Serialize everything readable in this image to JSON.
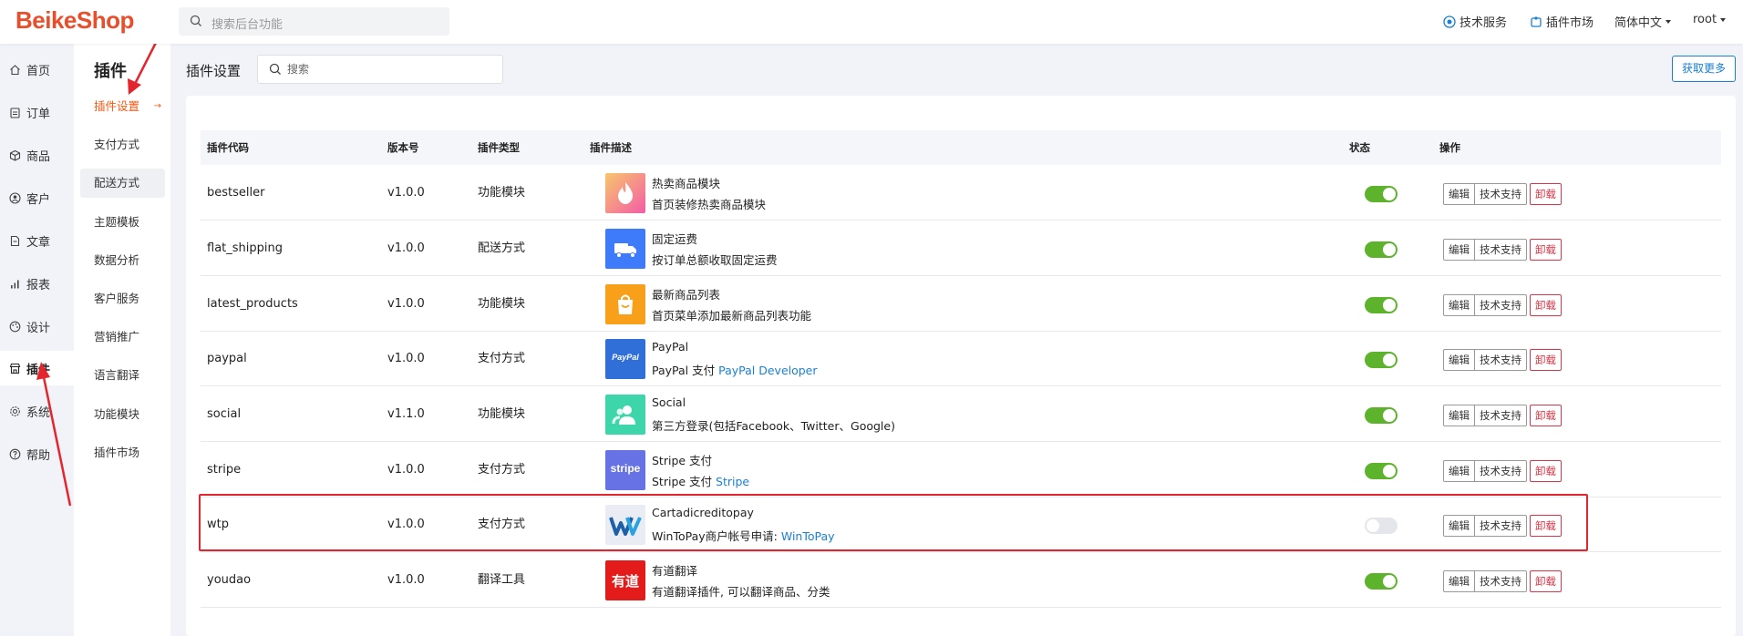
{
  "header": {
    "logo": "BeikeShop",
    "search_placeholder": "搜索后台功能",
    "tech_service": "技术服务",
    "plugin_market": "插件市场",
    "language": "简体中文",
    "user": "root"
  },
  "sidebar": {
    "items": [
      {
        "label": "首页",
        "icon": "home-icon"
      },
      {
        "label": "订单",
        "icon": "clipboard-icon"
      },
      {
        "label": "商品",
        "icon": "box-icon"
      },
      {
        "label": "客户",
        "icon": "user-icon"
      },
      {
        "label": "文章",
        "icon": "document-icon"
      },
      {
        "label": "报表",
        "icon": "chart-icon"
      },
      {
        "label": "设计",
        "icon": "palette-icon"
      },
      {
        "label": "插件",
        "icon": "store-icon"
      },
      {
        "label": "系统",
        "icon": "gear-icon"
      },
      {
        "label": "帮助",
        "icon": "question-icon"
      }
    ]
  },
  "subnav": {
    "title": "插件",
    "items": [
      {
        "label": "插件设置"
      },
      {
        "label": "支付方式"
      },
      {
        "label": "配送方式"
      },
      {
        "label": "主题模板"
      },
      {
        "label": "数据分析"
      },
      {
        "label": "客户服务"
      },
      {
        "label": "营销推广"
      },
      {
        "label": "语言翻译"
      },
      {
        "label": "功能模块"
      },
      {
        "label": "插件市场"
      }
    ]
  },
  "main": {
    "title": "插件设置",
    "search_placeholder": "搜索",
    "more_button": "获取更多",
    "columns": {
      "code": "插件代码",
      "version": "版本号",
      "type": "插件类型",
      "desc": "插件描述",
      "status": "状态",
      "actions": "操作"
    },
    "action_labels": {
      "edit": "编辑",
      "tech": "技术支持",
      "uninstall": "卸载"
    },
    "rows": [
      {
        "code": "bestseller",
        "version": "v1.0.0",
        "type": "功能模块",
        "name": "热卖商品模块",
        "desc": "首页装修热卖商品模块",
        "link": "",
        "enabled": true,
        "icon": "flame-icon"
      },
      {
        "code": "flat_shipping",
        "version": "v1.0.0",
        "type": "配送方式",
        "name": "固定运费",
        "desc": "按订单总额收取固定运费",
        "link": "",
        "enabled": true,
        "icon": "truck-icon"
      },
      {
        "code": "latest_products",
        "version": "v1.0.0",
        "type": "功能模块",
        "name": "最新商品列表",
        "desc": "首页菜单添加最新商品列表功能",
        "link": "",
        "enabled": true,
        "icon": "shopping-bag-icon"
      },
      {
        "code": "paypal",
        "version": "v1.0.0",
        "type": "支付方式",
        "name": "PayPal",
        "desc": "PayPal 支付",
        "link": "PayPal Developer",
        "enabled": true,
        "icon": "paypal-icon",
        "icon_text": "PayPal"
      },
      {
        "code": "social",
        "version": "v1.1.0",
        "type": "功能模块",
        "name": "Social",
        "desc": "第三方登录(包括Facebook、Twitter、Google)",
        "link": "",
        "enabled": true,
        "icon": "people-icon"
      },
      {
        "code": "stripe",
        "version": "v1.0.0",
        "type": "支付方式",
        "name": "Stripe 支付",
        "desc": "Stripe 支付",
        "link": "Stripe",
        "enabled": true,
        "icon": "stripe-icon",
        "icon_text": "stripe"
      },
      {
        "code": "wtp",
        "version": "v1.0.0",
        "type": "支付方式",
        "name": "Cartadicreditopay",
        "desc": "WinToPay商户帐号申请:",
        "link": "WinToPay",
        "enabled": false,
        "icon": "wintopay-icon"
      },
      {
        "code": "youdao",
        "version": "v1.0.0",
        "type": "翻译工具",
        "name": "有道翻译",
        "desc": "有道翻译插件, 可以翻译商品、分类",
        "link": "",
        "enabled": true,
        "icon": "youdao-icon",
        "icon_text": "有道"
      }
    ]
  },
  "colors": {
    "brand": "#e84e2c",
    "active_sub": "#fd560f",
    "toggle_on": "#5db42c",
    "link": "#1a7fd6",
    "danger": "#dc3545",
    "highlight": "#e3262e"
  }
}
